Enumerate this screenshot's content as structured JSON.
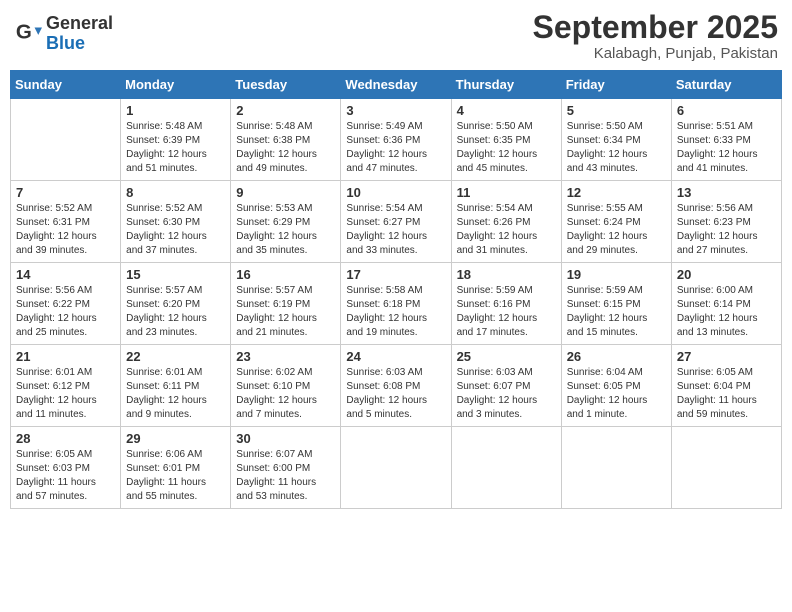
{
  "header": {
    "logo": {
      "general": "General",
      "blue": "Blue"
    },
    "title": "September 2025",
    "location": "Kalabagh, Punjab, Pakistan"
  },
  "weekdays": [
    "Sunday",
    "Monday",
    "Tuesday",
    "Wednesday",
    "Thursday",
    "Friday",
    "Saturday"
  ],
  "weeks": [
    [
      {
        "day": "",
        "info": ""
      },
      {
        "day": "1",
        "info": "Sunrise: 5:48 AM\nSunset: 6:39 PM\nDaylight: 12 hours\nand 51 minutes."
      },
      {
        "day": "2",
        "info": "Sunrise: 5:48 AM\nSunset: 6:38 PM\nDaylight: 12 hours\nand 49 minutes."
      },
      {
        "day": "3",
        "info": "Sunrise: 5:49 AM\nSunset: 6:36 PM\nDaylight: 12 hours\nand 47 minutes."
      },
      {
        "day": "4",
        "info": "Sunrise: 5:50 AM\nSunset: 6:35 PM\nDaylight: 12 hours\nand 45 minutes."
      },
      {
        "day": "5",
        "info": "Sunrise: 5:50 AM\nSunset: 6:34 PM\nDaylight: 12 hours\nand 43 minutes."
      },
      {
        "day": "6",
        "info": "Sunrise: 5:51 AM\nSunset: 6:33 PM\nDaylight: 12 hours\nand 41 minutes."
      }
    ],
    [
      {
        "day": "7",
        "info": "Sunrise: 5:52 AM\nSunset: 6:31 PM\nDaylight: 12 hours\nand 39 minutes."
      },
      {
        "day": "8",
        "info": "Sunrise: 5:52 AM\nSunset: 6:30 PM\nDaylight: 12 hours\nand 37 minutes."
      },
      {
        "day": "9",
        "info": "Sunrise: 5:53 AM\nSunset: 6:29 PM\nDaylight: 12 hours\nand 35 minutes."
      },
      {
        "day": "10",
        "info": "Sunrise: 5:54 AM\nSunset: 6:27 PM\nDaylight: 12 hours\nand 33 minutes."
      },
      {
        "day": "11",
        "info": "Sunrise: 5:54 AM\nSunset: 6:26 PM\nDaylight: 12 hours\nand 31 minutes."
      },
      {
        "day": "12",
        "info": "Sunrise: 5:55 AM\nSunset: 6:24 PM\nDaylight: 12 hours\nand 29 minutes."
      },
      {
        "day": "13",
        "info": "Sunrise: 5:56 AM\nSunset: 6:23 PM\nDaylight: 12 hours\nand 27 minutes."
      }
    ],
    [
      {
        "day": "14",
        "info": "Sunrise: 5:56 AM\nSunset: 6:22 PM\nDaylight: 12 hours\nand 25 minutes."
      },
      {
        "day": "15",
        "info": "Sunrise: 5:57 AM\nSunset: 6:20 PM\nDaylight: 12 hours\nand 23 minutes."
      },
      {
        "day": "16",
        "info": "Sunrise: 5:57 AM\nSunset: 6:19 PM\nDaylight: 12 hours\nand 21 minutes."
      },
      {
        "day": "17",
        "info": "Sunrise: 5:58 AM\nSunset: 6:18 PM\nDaylight: 12 hours\nand 19 minutes."
      },
      {
        "day": "18",
        "info": "Sunrise: 5:59 AM\nSunset: 6:16 PM\nDaylight: 12 hours\nand 17 minutes."
      },
      {
        "day": "19",
        "info": "Sunrise: 5:59 AM\nSunset: 6:15 PM\nDaylight: 12 hours\nand 15 minutes."
      },
      {
        "day": "20",
        "info": "Sunrise: 6:00 AM\nSunset: 6:14 PM\nDaylight: 12 hours\nand 13 minutes."
      }
    ],
    [
      {
        "day": "21",
        "info": "Sunrise: 6:01 AM\nSunset: 6:12 PM\nDaylight: 12 hours\nand 11 minutes."
      },
      {
        "day": "22",
        "info": "Sunrise: 6:01 AM\nSunset: 6:11 PM\nDaylight: 12 hours\nand 9 minutes."
      },
      {
        "day": "23",
        "info": "Sunrise: 6:02 AM\nSunset: 6:10 PM\nDaylight: 12 hours\nand 7 minutes."
      },
      {
        "day": "24",
        "info": "Sunrise: 6:03 AM\nSunset: 6:08 PM\nDaylight: 12 hours\nand 5 minutes."
      },
      {
        "day": "25",
        "info": "Sunrise: 6:03 AM\nSunset: 6:07 PM\nDaylight: 12 hours\nand 3 minutes."
      },
      {
        "day": "26",
        "info": "Sunrise: 6:04 AM\nSunset: 6:05 PM\nDaylight: 12 hours\nand 1 minute."
      },
      {
        "day": "27",
        "info": "Sunrise: 6:05 AM\nSunset: 6:04 PM\nDaylight: 11 hours\nand 59 minutes."
      }
    ],
    [
      {
        "day": "28",
        "info": "Sunrise: 6:05 AM\nSunset: 6:03 PM\nDaylight: 11 hours\nand 57 minutes."
      },
      {
        "day": "29",
        "info": "Sunrise: 6:06 AM\nSunset: 6:01 PM\nDaylight: 11 hours\nand 55 minutes."
      },
      {
        "day": "30",
        "info": "Sunrise: 6:07 AM\nSunset: 6:00 PM\nDaylight: 11 hours\nand 53 minutes."
      },
      {
        "day": "",
        "info": ""
      },
      {
        "day": "",
        "info": ""
      },
      {
        "day": "",
        "info": ""
      },
      {
        "day": "",
        "info": ""
      }
    ]
  ]
}
